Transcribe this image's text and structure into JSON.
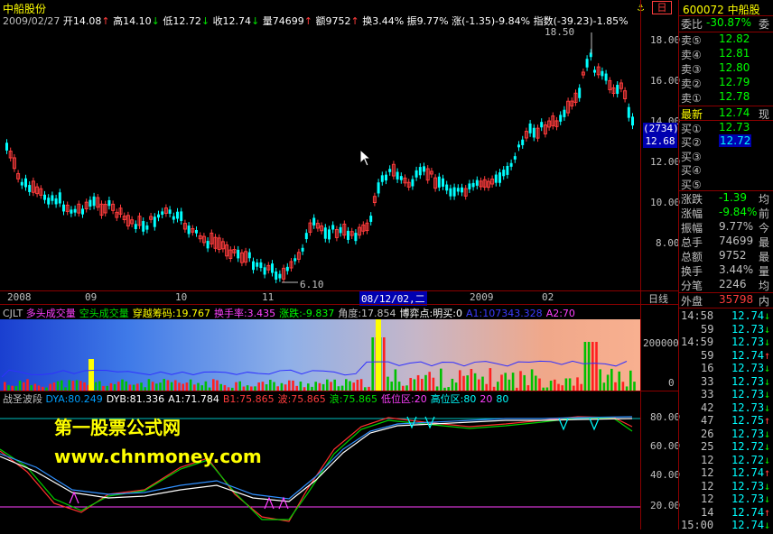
{
  "stock": {
    "name": "中船股份",
    "code": "600072",
    "short_name": "中船股",
    "alert_symbol": "⚓",
    "alert_text": "日"
  },
  "header": {
    "date": "2009/02/27",
    "open": "开14.08",
    "high": "高14.10",
    "low": "低12.72",
    "close": "收12.74",
    "volume": "量74699",
    "amount": "额9752",
    "turnover": "换3.44%",
    "amplitude": "振9.77%",
    "change": "涨(-1.35)-9.84%",
    "index": "指数(-39.23)-1.85%"
  },
  "price_axis": [
    "18.00",
    "16.00",
    "14.00",
    "12.00",
    "10.00",
    "8.00"
  ],
  "price_marks": {
    "high_label": "18.50",
    "low_label": "6.10",
    "cursor_count": "(2734)",
    "cursor_price": "12.68"
  },
  "time_axis": [
    "2008",
    "09",
    "10",
    "11",
    "08/12/02,二",
    "2009",
    "02"
  ],
  "period_label": "日线",
  "volume_panel": {
    "title": "CJLT",
    "items": [
      {
        "text": "多头成交量",
        "color": "#ff40ff"
      },
      {
        "text": "空头成交量",
        "color": "#00e000"
      },
      {
        "text": "穿越筹码:19.767",
        "color": "#ffff00"
      },
      {
        "text": "换手率:3.435",
        "color": "#ff40ff"
      },
      {
        "text": "涨跌:-9.837",
        "color": "#00ff00"
      },
      {
        "text": "角度:17.854",
        "color": "#c0c0c0"
      },
      {
        "text": "博弈点:明买:0",
        "color": "#ffffff"
      },
      {
        "text": "A1:107343.328",
        "color": "#3c3cff"
      },
      {
        "text": "A2:70",
        "color": "#ff40ff"
      }
    ],
    "axis": [
      "200000",
      "0"
    ]
  },
  "wave_panel": {
    "title": "战圣波段",
    "items": [
      {
        "text": "DYA:80.249",
        "color": "#00a0ff"
      },
      {
        "text": "DYB:81.336",
        "color": "#ffffff"
      },
      {
        "text": "A1:71.784",
        "color": "#ffffff"
      },
      {
        "text": "B1:75.865",
        "color": "#ff3c3c"
      },
      {
        "text": "波:75.865",
        "color": "#ff3c3c"
      },
      {
        "text": "浪:75.865",
        "color": "#00e000"
      },
      {
        "text": "低位区:20",
        "color": "#ff40ff"
      },
      {
        "text": "高位区:80",
        "color": "#00ffff"
      },
      {
        "text": "20",
        "color": "#ff40ff"
      },
      {
        "text": "80",
        "color": "#00ffff"
      }
    ],
    "axis": [
      "80.00",
      "60.00",
      "40.00",
      "20.00"
    ]
  },
  "watermark": {
    "line1": "第一股票公式网",
    "line2": "www.chnmoney.com"
  },
  "quote": {
    "ratio_label": "委比",
    "ratio_value": "-30.87%",
    "ratio_extra": "委",
    "asks": [
      {
        "label": "卖⑤",
        "price": "12.82"
      },
      {
        "label": "卖④",
        "price": "12.81"
      },
      {
        "label": "卖③",
        "price": "12.80"
      },
      {
        "label": "卖②",
        "price": "12.79"
      },
      {
        "label": "卖①",
        "price": "12.78"
      }
    ],
    "last_label": "最新",
    "last_price": "12.74",
    "last_extra": "现",
    "bids": [
      {
        "label": "买①",
        "price": "12.73"
      },
      {
        "label": "买②",
        "price": "12.72"
      },
      {
        "label": "买③",
        "price": ""
      },
      {
        "label": "买④",
        "price": ""
      },
      {
        "label": "买⑤",
        "price": ""
      }
    ],
    "stats": [
      {
        "label": "涨跌",
        "value": "-1.39",
        "extra": "均",
        "color": "#00ff00"
      },
      {
        "label": "涨幅",
        "value": "-9.84%",
        "extra": "前",
        "color": "#00ff00"
      },
      {
        "label": "振幅",
        "value": "9.77%",
        "extra": "今",
        "color": "#c0c0c0"
      },
      {
        "label": "总手",
        "value": "74699",
        "extra": "最",
        "color": "#c0c0c0"
      },
      {
        "label": "总额",
        "value": "9752",
        "extra": "最",
        "color": "#c0c0c0"
      },
      {
        "label": "换手",
        "value": "3.44%",
        "extra": "量",
        "color": "#c0c0c0"
      },
      {
        "label": "分笔",
        "value": "2246",
        "extra": "均",
        "color": "#c0c0c0"
      }
    ],
    "outer_label": "外盘",
    "outer_value": "35798",
    "inner_label": "内"
  },
  "ticks": [
    {
      "time": "14:58",
      "price": "12.74",
      "dir": "↓"
    },
    {
      "time": "59",
      "price": "12.73",
      "dir": "↓"
    },
    {
      "time": "14:59",
      "price": "12.73",
      "dir": "↓"
    },
    {
      "time": "59",
      "price": "12.74",
      "dir": "↑"
    },
    {
      "time": "16",
      "price": "12.73",
      "dir": "↓"
    },
    {
      "time": "33",
      "price": "12.73",
      "dir": "↓"
    },
    {
      "time": "33",
      "price": "12.73",
      "dir": "↓"
    },
    {
      "time": "42",
      "price": "12.73",
      "dir": "↓"
    },
    {
      "time": "47",
      "price": "12.75",
      "dir": "↑"
    },
    {
      "time": "26",
      "price": "12.73",
      "dir": "↓"
    },
    {
      "time": "25",
      "price": "12.72",
      "dir": "↓"
    },
    {
      "time": "12",
      "price": "12.72",
      "dir": "↓"
    },
    {
      "time": "12",
      "price": "12.74",
      "dir": "↑"
    },
    {
      "time": "12",
      "price": "12.73",
      "dir": "↓"
    },
    {
      "time": "12",
      "price": "12.73",
      "dir": "↓"
    },
    {
      "time": "14",
      "price": "12.74",
      "dir": "↑"
    },
    {
      "time": "15:00",
      "price": "12.74",
      "dir": "↓"
    }
  ]
}
